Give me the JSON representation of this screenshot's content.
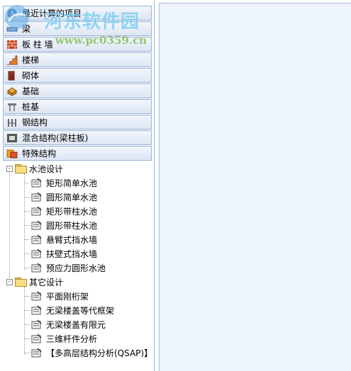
{
  "categories": [
    {
      "label": "最近计算的项目",
      "icon": "recent-icon"
    },
    {
      "label": "梁",
      "icon": "beam-icon"
    },
    {
      "label": "板 柱 墙",
      "icon": "brick-wall-icon"
    },
    {
      "label": "楼梯",
      "icon": "stairs-icon"
    },
    {
      "label": "砌体",
      "icon": "masonry-icon"
    },
    {
      "label": "基础",
      "icon": "foundation-icon"
    },
    {
      "label": "桩基",
      "icon": "pile-icon"
    },
    {
      "label": "钢结构",
      "icon": "steel-icon"
    },
    {
      "label": "混合结构(梁柱板)",
      "icon": "mixed-structure-icon"
    },
    {
      "label": "特殊结构",
      "icon": "special-structure-icon"
    }
  ],
  "tree": {
    "groups": [
      {
        "label": "水池设计",
        "expander": "-",
        "items": [
          "矩形简单水池",
          "圆形简单水池",
          "矩形带柱水池",
          "圆形带柱水池",
          "悬臂式挡水墙",
          "扶壁式挡水墙",
          "预应力圆形水池"
        ]
      },
      {
        "label": "其它设计",
        "expander": "-",
        "items": [
          "平面刚桁架",
          "无梁楼盖等代框架",
          "无梁楼盖有限元",
          "三维杆件分析",
          "【多高层结构分析(QSAP)】"
        ]
      }
    ]
  },
  "watermark": {
    "title": "河东软件园",
    "url": "www.pc0359.cn"
  },
  "colors": {
    "panel_bg": "#eef5fc",
    "category_border": "#9db3d6"
  }
}
